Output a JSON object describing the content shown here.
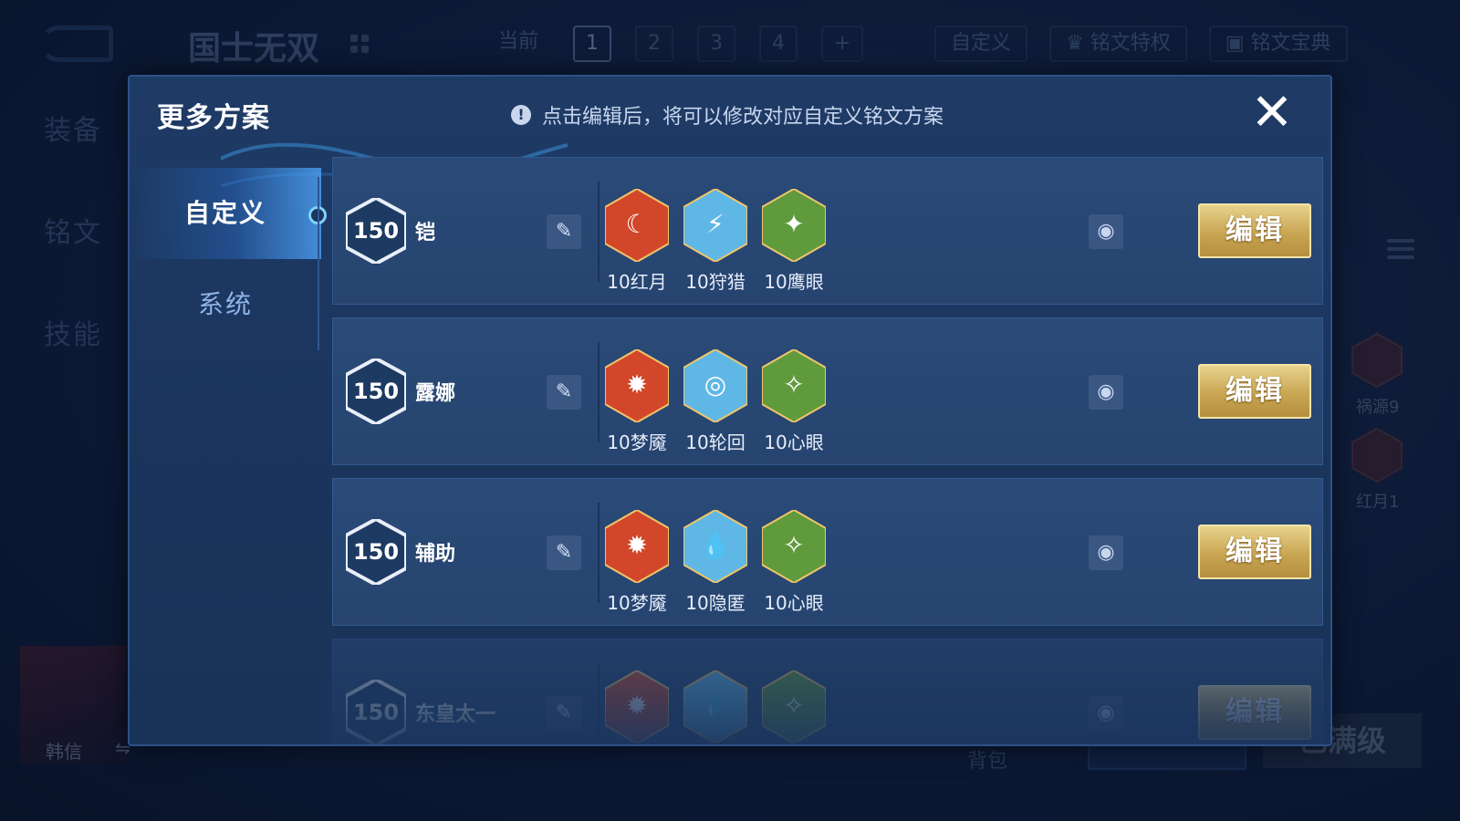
{
  "background": {
    "preset_title": "国士无双",
    "top_tabs": [
      "当前",
      "1",
      "2",
      "3",
      "4",
      "+"
    ],
    "custom_label": "自定义",
    "privilege_label": "铭文特权",
    "handbook_label": "铭文宝典",
    "left_tabs": [
      "装备",
      "铭文",
      "技能"
    ],
    "hero_name": "韩信",
    "bag_label": "背包",
    "max_level_label": "已满级",
    "right_runes": [
      {
        "label": "祸源9",
        "color": "#8a2e2e"
      },
      {
        "label": "红月1",
        "color": "#8a2e2e"
      }
    ]
  },
  "modal": {
    "title": "更多方案",
    "hint_icon": "!",
    "hint": "点击编辑后，将可以修改对应自定义铭文方案",
    "close_label": "✕",
    "side_tabs": [
      {
        "label": "自定义",
        "active": true
      },
      {
        "label": "系统",
        "active": false
      }
    ],
    "plans": [
      {
        "level": "150",
        "name": "铠",
        "runes": [
          {
            "label": "10红月",
            "color": "#d2472a",
            "icon": "crescent-moon-icon",
            "glyph": "☾"
          },
          {
            "label": "10狩猎",
            "color": "#5fb7e6",
            "icon": "lightning-icon",
            "glyph": "⚡"
          },
          {
            "label": "10鹰眼",
            "color": "#5f9a3c",
            "icon": "eagle-eye-icon",
            "glyph": "✦"
          }
        ],
        "edit_label": "编辑",
        "faded": false
      },
      {
        "level": "150",
        "name": "露娜",
        "runes": [
          {
            "label": "10梦魇",
            "color": "#d2472a",
            "icon": "nightmare-icon",
            "glyph": "✹"
          },
          {
            "label": "10轮回",
            "color": "#5fb7e6",
            "icon": "swirl-icon",
            "glyph": "◎"
          },
          {
            "label": "10心眼",
            "color": "#5f9a3c",
            "icon": "heart-eye-icon",
            "glyph": "✧"
          }
        ],
        "edit_label": "编辑",
        "faded": false
      },
      {
        "level": "150",
        "name": "辅助",
        "runes": [
          {
            "label": "10梦魇",
            "color": "#d2472a",
            "icon": "nightmare-icon",
            "glyph": "✹"
          },
          {
            "label": "10隐匿",
            "color": "#5fb7e6",
            "icon": "water-drop-icon",
            "glyph": "💧"
          },
          {
            "label": "10心眼",
            "color": "#5f9a3c",
            "icon": "heart-eye-icon",
            "glyph": "✧"
          }
        ],
        "edit_label": "编辑",
        "faded": false
      },
      {
        "level": "150",
        "name": "东皇太一",
        "runes": [
          {
            "label": "",
            "color": "#d2472a",
            "icon": "nightmare-icon",
            "glyph": "✹"
          },
          {
            "label": "",
            "color": "#5fb7e6",
            "icon": "water-drop-icon",
            "glyph": "💧"
          },
          {
            "label": "",
            "color": "#5f9a3c",
            "icon": "heart-eye-icon",
            "glyph": "✧"
          }
        ],
        "edit_label": "编辑",
        "faded": true
      }
    ]
  }
}
